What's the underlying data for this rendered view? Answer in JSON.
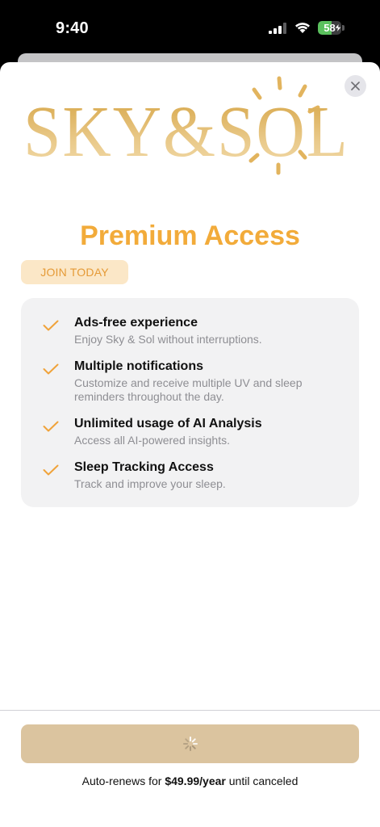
{
  "status_bar": {
    "time": "9:40",
    "battery_percent": "58",
    "battery_level": 0.58,
    "icons": [
      "signal-icon",
      "wifi-icon",
      "battery-icon",
      "charging-bolt-icon"
    ]
  },
  "logo": {
    "text": "SKY&SOL",
    "icon": "sun-icon"
  },
  "close_icon": "close-icon",
  "title": "Premium Access",
  "badge": "JOIN TODAY",
  "features": [
    {
      "title": "Ads-free experience",
      "description": "Enjoy Sky & Sol without interruptions."
    },
    {
      "title": "Multiple notifications",
      "description": "Customize and receive multiple UV and sleep reminders throughout the day."
    },
    {
      "title": "Unlimited usage of AI Analysis",
      "description": "Access all AI-powered insights."
    },
    {
      "title": "Sleep Tracking Access",
      "description": "Track and improve your sleep."
    }
  ],
  "purchase": {
    "state": "loading",
    "icon": "spinner-icon"
  },
  "renewal": {
    "prefix": "Auto-renews for",
    "price": "$49.99/year",
    "suffix": "until canceled"
  },
  "colors": {
    "accent": "#f2ab3a",
    "badge_bg": "#fbe7c7",
    "button_bg": "#dbc49f",
    "logo_gold": "#dfb464"
  }
}
